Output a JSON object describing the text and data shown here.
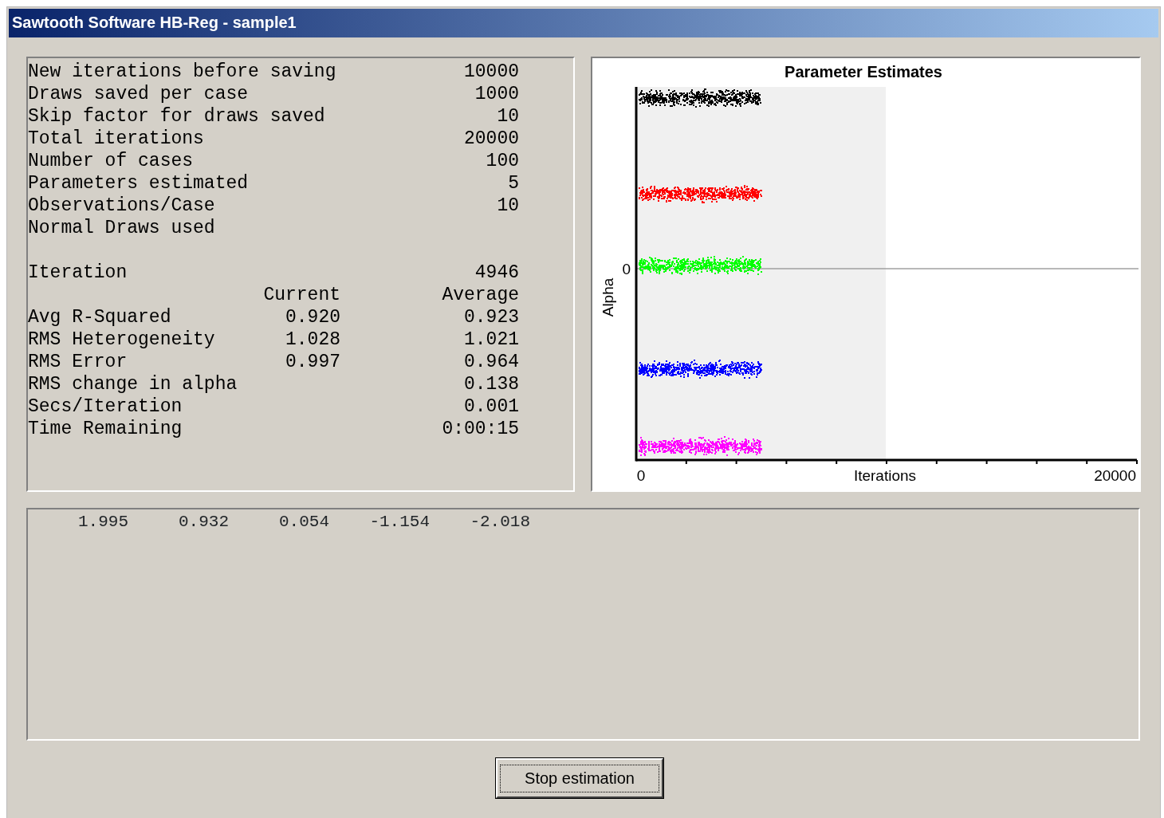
{
  "window": {
    "title": "Sawtooth Software HB-Reg - sample1"
  },
  "stats": [
    {
      "rows": [
        {
          "label": "New iterations before saving",
          "value": "10000"
        },
        {
          "label": "Draws saved per case",
          "value": "1000"
        },
        {
          "label": "Skip factor for draws saved",
          "value": "10"
        },
        {
          "label": "Total iterations",
          "value": "20000"
        },
        {
          "label": "Number of cases",
          "value": "100"
        },
        {
          "label": "Parameters estimated",
          "value": "5"
        },
        {
          "label": "Observations/Case",
          "value": "10"
        },
        {
          "label": "Normal Draws used"
        }
      ]
    },
    {
      "rows": [
        {
          "label": "Iteration",
          "value": "4946"
        },
        {
          "current": "Current",
          "value": "Average"
        },
        {
          "label": "Avg R-Squared",
          "current": "0.920",
          "value": "0.923"
        },
        {
          "label": "RMS Heterogeneity",
          "current": "1.028",
          "value": "1.021"
        },
        {
          "label": "RMS Error",
          "current": "0.997",
          "value": "0.964"
        },
        {
          "label": "RMS change in alpha",
          "value": "0.138"
        },
        {
          "label": "Secs/Iteration",
          "value": "0.001"
        },
        {
          "label": "Time Remaining",
          "value": "0:00:15"
        }
      ]
    }
  ],
  "chart": {
    "title": "Parameter Estimates",
    "ylabel": "Alpha",
    "ytick": "0",
    "xlabel": "Iterations",
    "xtick_start": "0",
    "xtick_end": "20000",
    "series": [
      {
        "color": "#000000"
      },
      {
        "color": "#ff0000"
      },
      {
        "color": "#00ff00"
      },
      {
        "color": "#0000ff"
      },
      {
        "color": "#ff00ff"
      }
    ]
  },
  "estimates": [
    "1.995",
    "0.932",
    "0.054",
    "-1.154",
    "-2.018"
  ],
  "buttons": [
    {
      "label": "Stop estimation"
    }
  ]
}
